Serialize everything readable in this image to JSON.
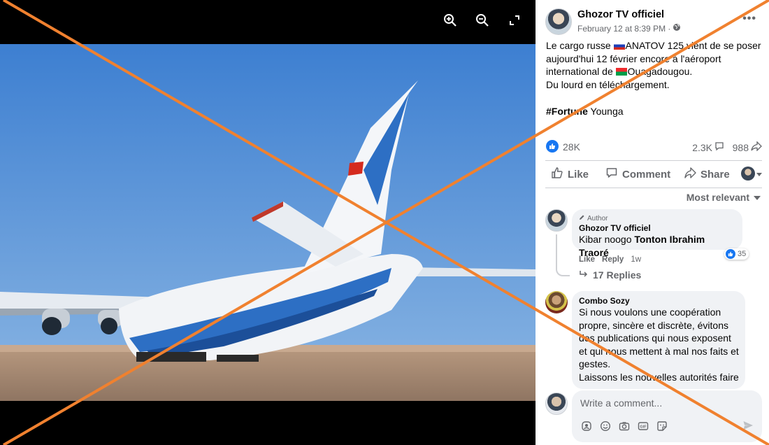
{
  "viewer": {
    "zoom_in_icon": "zoom-in-icon",
    "zoom_out_icon": "zoom-out-icon",
    "fullscreen_icon": "expand-icon"
  },
  "post": {
    "author": "Ghozor TV officiel",
    "timestamp": "February 12 at 8:39 PM ·",
    "text_lines": [
      "Le cargo russe ",
      "ANATOV 125 vient de se poser",
      "aujourd'hui 12 février encore à l'aéroport",
      "international de ",
      "Ouagadougou.",
      "Du lourd en téléchargement.",
      "#Fortune",
      " Younga"
    ],
    "reactions_count": "28K",
    "comments_count": "2.3K",
    "shares_count": "988"
  },
  "actions": {
    "like": "Like",
    "comment": "Comment",
    "share": "Share"
  },
  "sort_label": "Most relevant",
  "comments": [
    {
      "author_tag": "Author",
      "name": "Ghozor TV officiel",
      "text_plain": "Kibar noogo ",
      "text_bold": "Tonton Ibrahim Traoré",
      "reaction_count": "35",
      "like": "Like",
      "reply": "Reply",
      "time": "1w",
      "replies": "17 Replies"
    },
    {
      "name": "Combo Sozy",
      "lines": [
        "Si nous voulons une coopération",
        "propre, sincère et discrète, évitons",
        "des publications qui nous exposent",
        "et qui nous mettent à mal nos faits et",
        "gestes.",
        "Laissons les nouvelles autorités faire"
      ]
    }
  ],
  "composer": {
    "placeholder": "Write a comment..."
  },
  "colors": {
    "accent": "#1877f2",
    "overlay_x": "#f0812f",
    "sky": "#5a93d6"
  }
}
